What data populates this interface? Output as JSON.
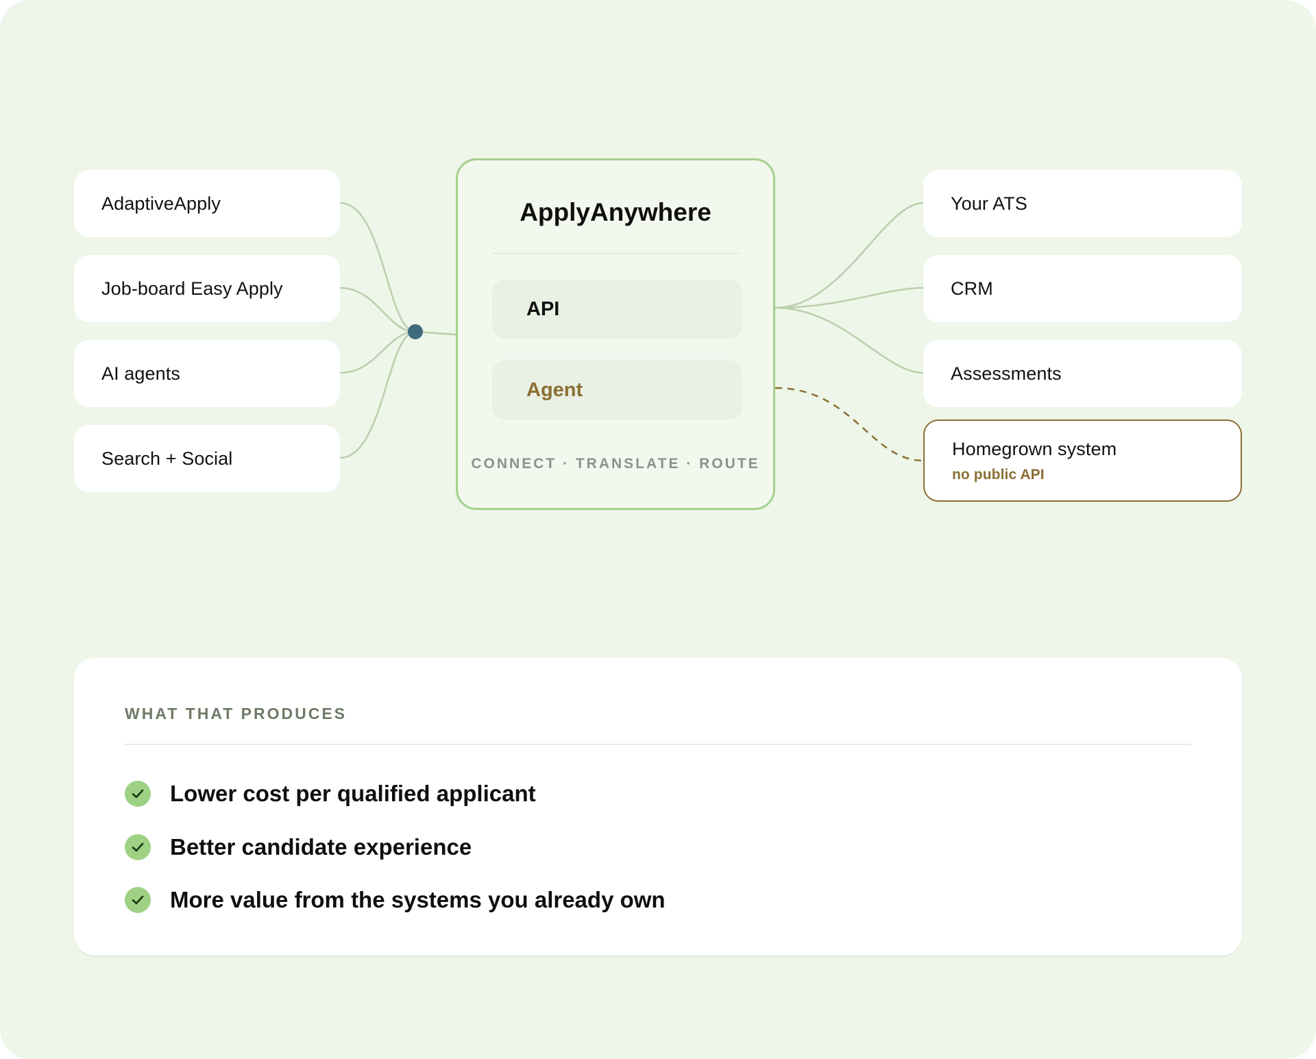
{
  "sources": [
    {
      "label": "AdaptiveApply"
    },
    {
      "label": "Job-board Easy Apply"
    },
    {
      "label": "AI agents"
    },
    {
      "label": "Search + Social"
    }
  ],
  "hub": {
    "title": "ApplyAnywhere",
    "api_label": "API",
    "agent_label": "Agent",
    "caption": "CONNECT · TRANSLATE · ROUTE"
  },
  "destinations": [
    {
      "label": "Your ATS"
    },
    {
      "label": "CRM"
    },
    {
      "label": "Assessments"
    }
  ],
  "homegrown": {
    "label": "Homegrown system",
    "note": "no public API"
  },
  "results": {
    "heading": "WHAT THAT PRODUCES",
    "items": [
      {
        "text": "Lower cost per qualified applicant"
      },
      {
        "text": "Better candidate experience"
      },
      {
        "text": "More value from the systems you already own"
      }
    ]
  },
  "colors": {
    "background": "#eef5e9",
    "hub_border": "#a3d18a",
    "connector": "#b9cfac",
    "junction_dot": "#3f6b7c",
    "agent_accent": "#8a6f33",
    "check": "#9fd184"
  }
}
